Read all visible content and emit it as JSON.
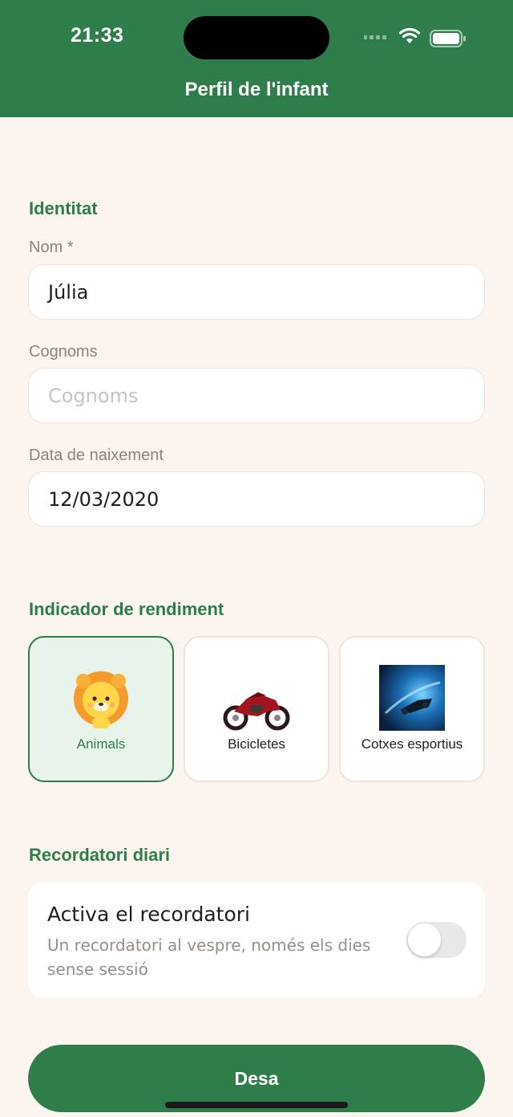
{
  "status_bar": {
    "time": "21:33"
  },
  "header": {
    "title": "Perfil de l'infant"
  },
  "identity": {
    "section_title": "Identitat",
    "name": {
      "label": "Nom *",
      "value": "Júlia"
    },
    "surname": {
      "label": "Cognoms",
      "placeholder": "Cognoms",
      "value": ""
    },
    "birthdate": {
      "label": "Data de naixement",
      "value": "12/03/2020"
    }
  },
  "indicator": {
    "section_title": "Indicador de rendiment",
    "options": [
      {
        "label": "Animals",
        "selected": true
      },
      {
        "label": "Bicicletes",
        "selected": false
      },
      {
        "label": "Cotxes esportius",
        "selected": false
      }
    ]
  },
  "reminder": {
    "section_title": "Recordatori diari",
    "title": "Activa el recordatori",
    "description": "Un recordatori al vespre, només els dies sense sessió",
    "enabled": false
  },
  "save_button": {
    "label": "Desa"
  },
  "colors": {
    "brand": "#2e7d4b",
    "background": "#fcf4ef",
    "selected_card": "#e8f4ea"
  }
}
